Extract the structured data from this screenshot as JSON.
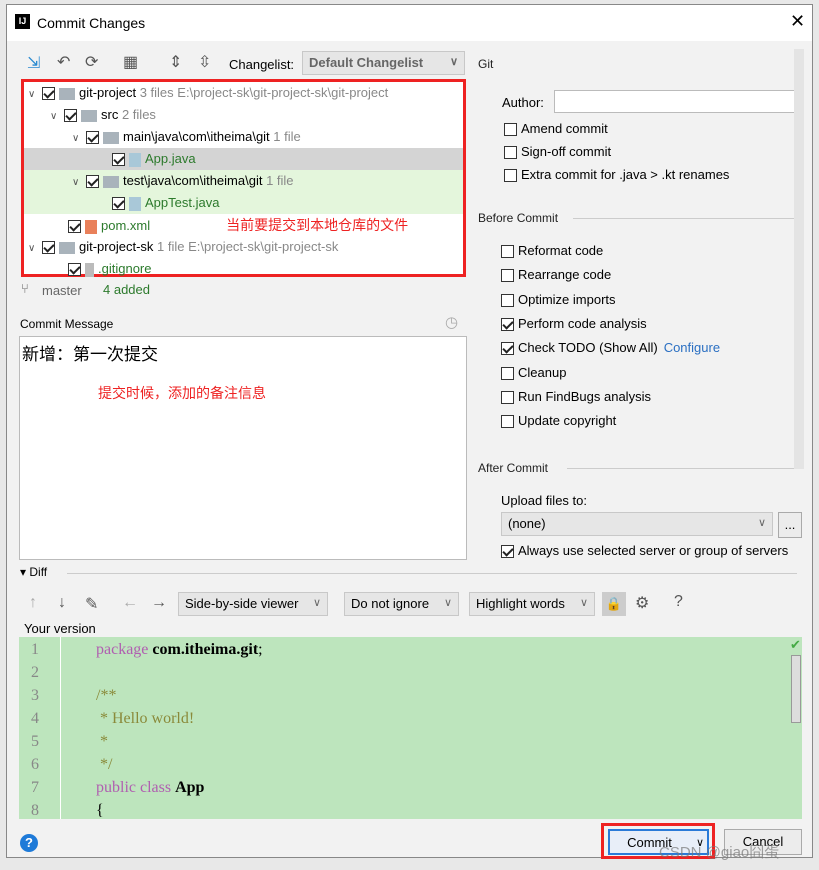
{
  "window": {
    "title": "Commit Changes"
  },
  "toolbar": {
    "changelist_label": "Changelist:",
    "changelist_value": "Default Changelist"
  },
  "tree": [
    {
      "name": "git-project",
      "meta": "3 files  E:\\project-sk\\git-project-sk\\git-project"
    },
    {
      "name": "src",
      "meta": "2 files"
    },
    {
      "name": "main\\java\\com\\itheima\\git",
      "meta": "1 file"
    },
    {
      "name": "App.java",
      "meta": ""
    },
    {
      "name": "test\\java\\com\\itheima\\git",
      "meta": "1 file"
    },
    {
      "name": "AppTest.java",
      "meta": ""
    },
    {
      "name": "pom.xml",
      "meta": ""
    },
    {
      "name": "git-project-sk",
      "meta": "1 file  E:\\project-sk\\git-project-sk"
    },
    {
      "name": ".gitignore",
      "meta": ""
    }
  ],
  "annotations": {
    "files": "当前要提交到本地仓库的文件",
    "message": "提交时候，添加的备注信息"
  },
  "status": {
    "branch": "master",
    "added": "4 added"
  },
  "commit_message": {
    "label": "Commit Message",
    "value": "新增：第一次提交"
  },
  "git": {
    "title": "Git",
    "author_label": "Author:",
    "author_value": "",
    "options": [
      {
        "label": "Amend commit",
        "checked": false
      },
      {
        "label": "Sign-off commit",
        "checked": false
      },
      {
        "label": "Extra commit for .java > .kt renames",
        "checked": false
      }
    ]
  },
  "before_commit": {
    "title": "Before Commit",
    "options": [
      {
        "label": "Reformat code",
        "checked": false
      },
      {
        "label": "Rearrange code",
        "checked": false
      },
      {
        "label": "Optimize imports",
        "checked": false
      },
      {
        "label": "Perform code analysis",
        "checked": true
      },
      {
        "label": "Check TODO (Show All)",
        "checked": true,
        "link": "Configure"
      },
      {
        "label": "Cleanup",
        "checked": false
      },
      {
        "label": "Run FindBugs analysis",
        "checked": false
      },
      {
        "label": "Update copyright",
        "checked": false
      }
    ]
  },
  "after_commit": {
    "title": "After Commit",
    "upload_label": "Upload files to:",
    "upload_value": "(none)",
    "browse": "...",
    "always_label": "Always use selected server or group of servers",
    "always_checked": true
  },
  "diff": {
    "title": "Diff",
    "viewer": "Side-by-side viewer",
    "ignore": "Do not ignore",
    "highlight": "Highlight words",
    "help": "?",
    "your_version": "Your version",
    "lines": [
      "1",
      "2",
      "3",
      "4",
      "5",
      "6",
      "7",
      "8"
    ]
  },
  "buttons": {
    "commit": "Commit",
    "cancel": "Cancel",
    "help": "?"
  },
  "watermark": "CSDN @giao囧蛋"
}
